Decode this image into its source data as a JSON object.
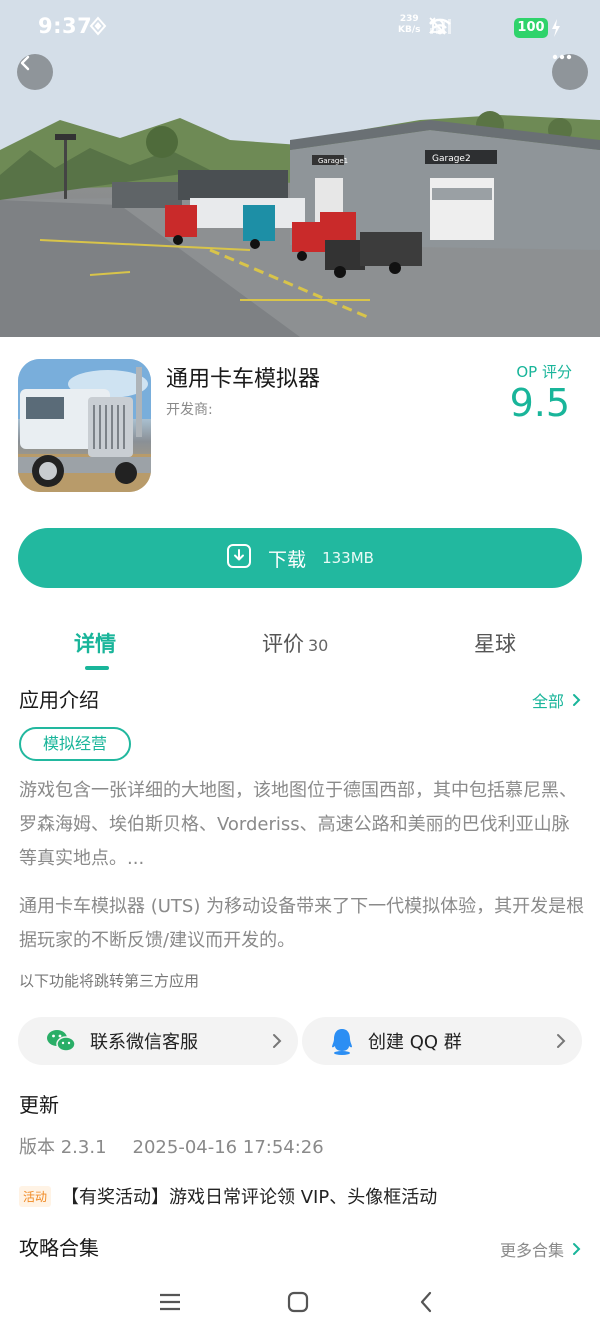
{
  "status_bar": {
    "time": "9:37",
    "net_speed_value": "239",
    "net_speed_unit": "KB/s",
    "battery": "100",
    "icons": [
      "shield-icon",
      "mute-icon",
      "signal-icon",
      "wifi-icon",
      "battery-icon",
      "charging-icon"
    ]
  },
  "hero": {
    "sign_left": "Garage1",
    "sign_right": "Garage2"
  },
  "nav": {
    "back_icon": "chevron-left-icon",
    "more_icon": "more-dots-icon"
  },
  "app": {
    "name": "通用卡车模拟器",
    "developer_label": "开发商:",
    "rating_label": "OP 评分",
    "rating_value": "9.5"
  },
  "download": {
    "label": "下载",
    "size": "133MB",
    "icon": "download-icon"
  },
  "tabs": [
    {
      "label": "详情",
      "active": true
    },
    {
      "label": "评价",
      "count": "30",
      "active": false
    },
    {
      "label": "星球",
      "active": false
    }
  ],
  "intro": {
    "title": "应用介绍",
    "more_label": "全部",
    "tag": "模拟经营",
    "paragraph1": "游戏包含一张详细的大地图，该地图位于德国西部，其中包括慕尼黑、罗森海姆、埃伯斯贝格、Vorderiss、高速公路和美丽的巴伐利亚山脉等真实地点。...",
    "paragraph2": "通用卡车模拟器 (UTS) 为移动设备带来了下一代模拟体验，其开发是根据玩家的不断反馈/建议而开发的。",
    "third_party_hint": "以下功能将跳转第三方应用",
    "contact_wechat": "联系微信客服",
    "contact_qq": "创建 QQ 群"
  },
  "update": {
    "title": "更新",
    "version": "版本 2.3.1",
    "date": "2025-04-16 17:54:26",
    "activity_badge": "活动",
    "activity_text": "【有奖活动】游戏日常评论领 VIP、头像框活动"
  },
  "guides": {
    "title": "攻略合集",
    "more_label": "更多合集"
  },
  "colors": {
    "accent": "#22b89f",
    "accent_text": "#19b59a",
    "battery": "#2fd36b",
    "activity": "#f08a24"
  }
}
